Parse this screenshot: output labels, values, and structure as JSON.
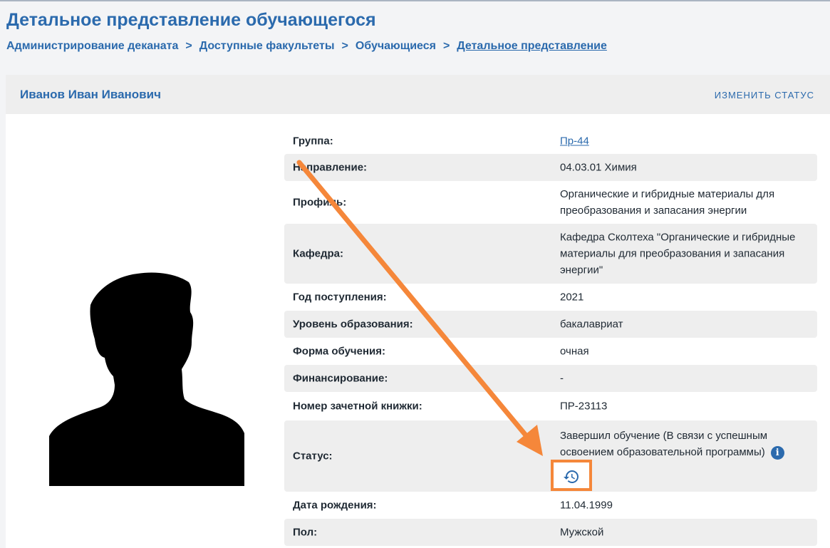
{
  "page": {
    "title": "Детальное представление обучающегося"
  },
  "breadcrumb": {
    "items": [
      "Администрирование деканата",
      "Доступные факультеты",
      "Обучающиеся",
      "Детальное представление"
    ],
    "separator": ">"
  },
  "student": {
    "name": "Иванов Иван Иванович",
    "change_status_label": "ИЗМЕНИТЬ СТАТУС"
  },
  "fields": [
    {
      "label": "Группа:",
      "value": "Пр-44"
    },
    {
      "label": "Направление:",
      "value": "04.03.01 Химия"
    },
    {
      "label": "Профиль:",
      "value": "Органические и гибридные материалы для преобразования и запасания энергии"
    },
    {
      "label": "Кафедра:",
      "value": "Кафедра Сколтеха \"Органические и гибридные материалы для преобразования и запасания энергии\""
    },
    {
      "label": "Год поступления:",
      "value": "2021"
    },
    {
      "label": "Уровень образования:",
      "value": "бакалавриат"
    },
    {
      "label": "Форма обучения:",
      "value": "очная"
    },
    {
      "label": "Финансирование:",
      "value": "-"
    },
    {
      "label": "Номер зачетной книжки:",
      "value": "ПР-23113"
    },
    {
      "label": "Статус:",
      "value": "Завершил обучение (В связи с успешным освоением образовательной программы)"
    },
    {
      "label": "Дата рождения:",
      "value": "11.04.1999"
    },
    {
      "label": "Пол:",
      "value": "Мужской"
    }
  ],
  "icons": {
    "info": "info-icon",
    "history": "history-icon"
  },
  "colors": {
    "brand": "#2b6aad",
    "highlight": "#f5873a"
  }
}
